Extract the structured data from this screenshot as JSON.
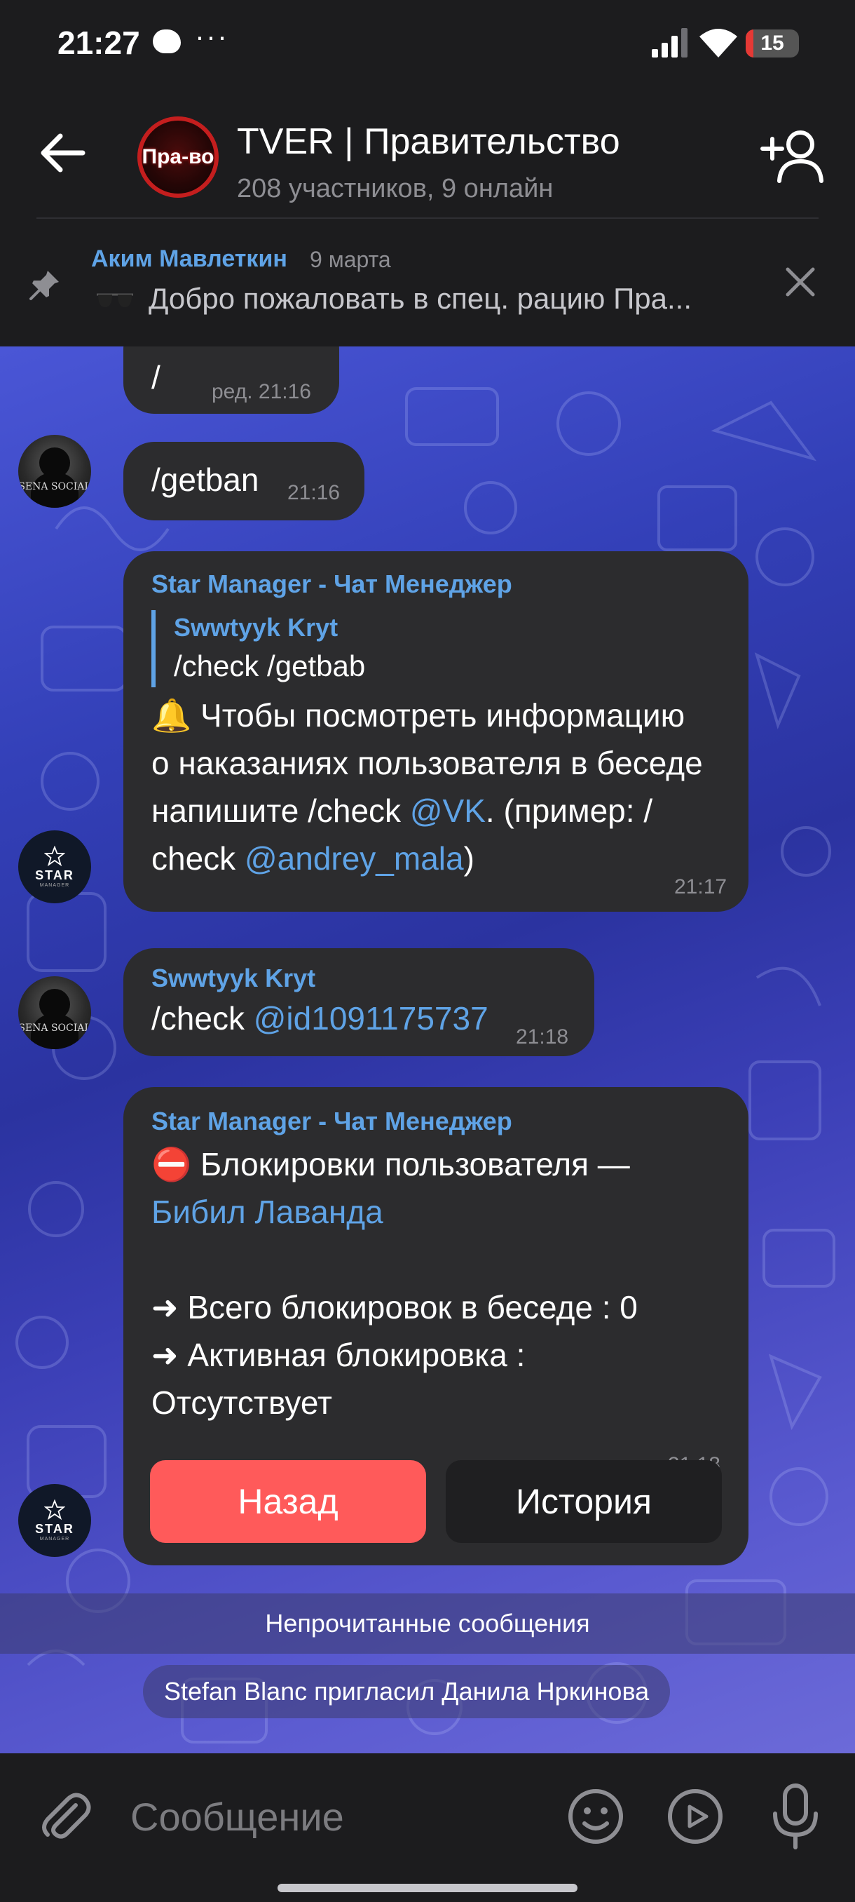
{
  "status_bar": {
    "time": "21:27",
    "dots": "···",
    "battery_level": "15",
    "battery_color": "#e53935"
  },
  "header": {
    "avatar_text": "Пра-во",
    "title": "TVER | Правительство",
    "subtitle": "208 участников, 9 онлайн",
    "icons": {
      "back": "arrow-left-icon",
      "add_member": "person-add-icon"
    }
  },
  "pinned": {
    "author": "Аким Мавлеткин",
    "date": "9 марта",
    "text": "Добро пожаловать в спец. рацию Пра...",
    "icons": {
      "pin": "pin-icon",
      "close": "close-icon",
      "prefix": "sunglasses-icon"
    }
  },
  "messages": [
    {
      "id": "m1",
      "text": "/",
      "time": "ред. 21:16"
    },
    {
      "id": "m2",
      "text": "/getban",
      "time": "21:16"
    },
    {
      "id": "m3",
      "sender": "Star Manager - Чат Менеджер",
      "reply": {
        "author": "Swwtyyk Kryt",
        "text": "/check /getbab"
      },
      "emoji": "🔔",
      "line1": " Чтобы посмотреть информацию",
      "line2": "о наказаниях пользователя в беседе",
      "line3_pre": "напишите /check ",
      "line3_link": "@VK",
      "line3_post": ". (пример: /",
      "line4_pre": "check ",
      "line4_link": "@andrey_mala",
      "line4_post": ")",
      "time": "21:17"
    },
    {
      "id": "m4",
      "sender": "Swwtyyk Kryt",
      "text_pre": "/check ",
      "text_link": "@id1091175737",
      "time": "21:18"
    },
    {
      "id": "m5",
      "sender": "Star Manager - Чат Менеджер",
      "emoji": "⛔",
      "line1": " Блокировки пользователя —",
      "line2_link": "Бибил Лаванда",
      "line3": "➜ Всего блокировок в беседе : 0",
      "line4": "➜ Активная блокировка :",
      "line5": "Отсутствует",
      "time": "ред. 21:18",
      "buttons": [
        {
          "label": "Назад",
          "color": "#ff5a5a"
        },
        {
          "label": "История",
          "color": "#1f1f21"
        }
      ]
    }
  ],
  "avatars": {
    "user_text": "SENA SOCIAL",
    "bot_text": "STAR",
    "bot_sub": "MANAGER"
  },
  "service": {
    "unread": "Непрочитанные сообщения",
    "invite": "Stefan Blanc пригласил Данила Нркинова"
  },
  "input": {
    "placeholder": "Сообщение",
    "icons": {
      "attach": "paperclip-icon",
      "emoji": "smile-icon",
      "video": "video-message-icon",
      "mic": "microphone-icon"
    }
  },
  "colors": {
    "accent": "#5fa3e6",
    "bubble": "#2c2c2e",
    "background": "#1c1c1e"
  }
}
